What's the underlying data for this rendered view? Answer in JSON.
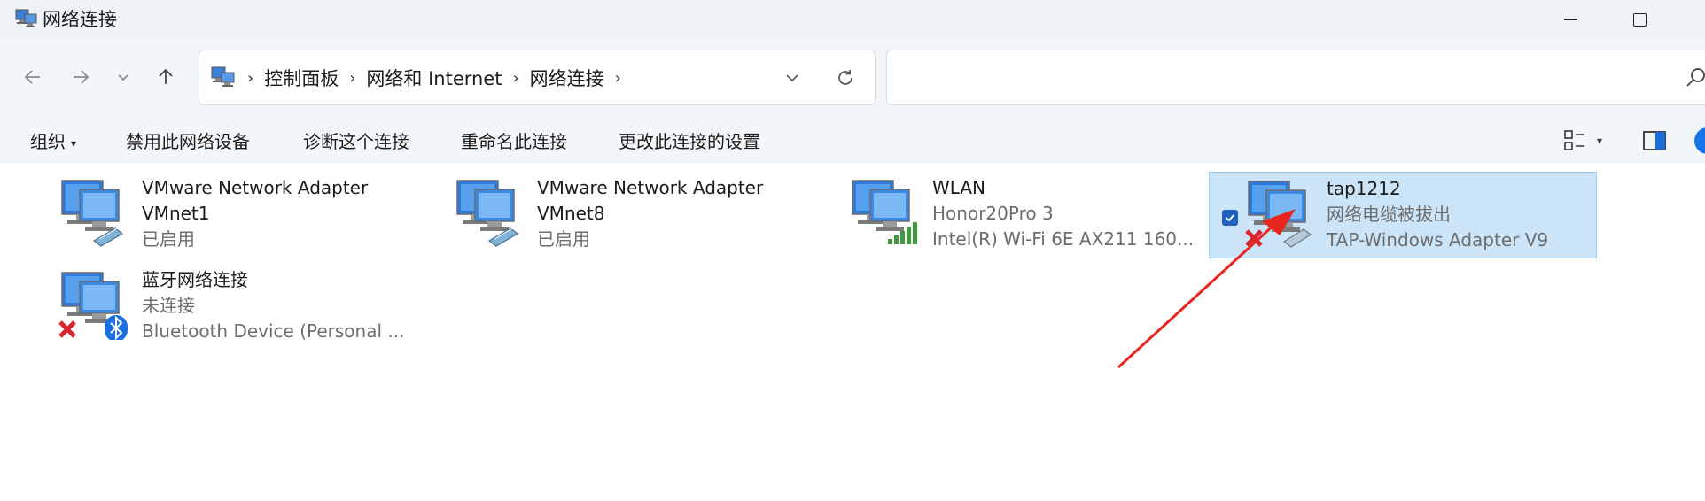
{
  "window": {
    "title": "网络连接"
  },
  "address": {
    "crumbs": [
      "控制面板",
      "网络和 Internet",
      "网络连接"
    ]
  },
  "search": {
    "placeholder": ""
  },
  "toolbar": {
    "organize": "组织",
    "disable": "禁用此网络设备",
    "diagnose": "诊断这个连接",
    "rename": "重命名此连接",
    "settings": "更改此连接的设置"
  },
  "connections": [
    {
      "name": "VMware Network Adapter VMnet1",
      "name_line1": "VMware Network Adapter",
      "name_line2": "VMnet1",
      "status": "已启用",
      "device": "",
      "icon": "network-adapter-icon",
      "selected": false
    },
    {
      "name": "VMware Network Adapter VMnet8",
      "name_line1": "VMware Network Adapter",
      "name_line2": "VMnet8",
      "status": "已启用",
      "device": "",
      "icon": "network-adapter-icon",
      "selected": false
    },
    {
      "name": "WLAN",
      "status": "Honor20Pro 3",
      "device": "Intel(R) Wi-Fi 6E AX211 160...",
      "icon": "wifi-adapter-icon",
      "selected": false
    },
    {
      "name": "tap1212",
      "status": "网络电缆被拔出",
      "device": "TAP-Windows Adapter V9",
      "icon": "disconnected-adapter-icon",
      "selected": true
    },
    {
      "name": "蓝牙网络连接",
      "status": "未连接",
      "device": "Bluetooth Device (Personal ...",
      "icon": "bluetooth-adapter-icon",
      "selected": false
    }
  ],
  "colors": {
    "selection_bg": "#cce4f7",
    "annotation_arrow": "#e8261f",
    "accent": "#1f5fbf"
  }
}
